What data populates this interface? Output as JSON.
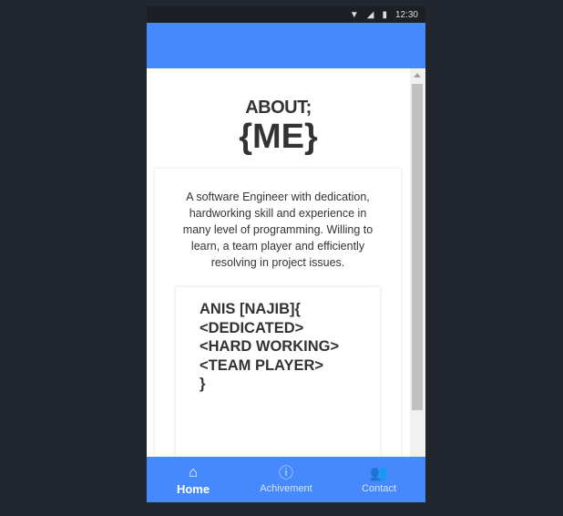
{
  "status": {
    "time": "12:30"
  },
  "about": {
    "title": "ABOUT;",
    "subtitle": "{ME}",
    "description": "A software Engineer with dedication, hardworking skill and experience in many level of programming. Willing to learn, a team player and efficiently resolving in project issues.",
    "code_lines": [
      "ANIS [NAJIB]{",
      "<DEDICATED>",
      "<HARD WORKING>",
      "<TEAM PLAYER>",
      "}"
    ]
  },
  "nav": {
    "items": [
      {
        "label": "Home",
        "icon": "home-icon"
      },
      {
        "label": "Achivement",
        "icon": "info-icon"
      },
      {
        "label": "Contact",
        "icon": "contacts-icon"
      }
    ]
  },
  "colors": {
    "primary": "#4689fc"
  }
}
